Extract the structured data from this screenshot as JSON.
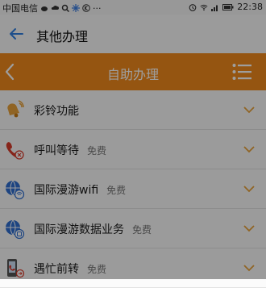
{
  "status_bar": {
    "carrier": "中国电信",
    "ellipsis": "···",
    "time": "22:38"
  },
  "title_bar": {
    "title": "其他办理"
  },
  "header": {
    "title": "自助办理"
  },
  "items": [
    {
      "label": "彩铃功能",
      "tag": "",
      "icon": "bell-icon"
    },
    {
      "label": "呼叫等待",
      "tag": "免费",
      "icon": "phone-wait-icon"
    },
    {
      "label": "国际漫游wifi",
      "tag": "免费",
      "icon": "globe-wifi-icon"
    },
    {
      "label": "国际漫游数据业务",
      "tag": "免费",
      "icon": "globe-data-icon"
    },
    {
      "label": "遇忙前转",
      "tag": "免费",
      "icon": "phone-forward-icon"
    }
  ],
  "colors": {
    "accent_orange": "#f08a1c",
    "back_blue": "#2f7fe0",
    "chevron_orange": "#e8a23a"
  }
}
